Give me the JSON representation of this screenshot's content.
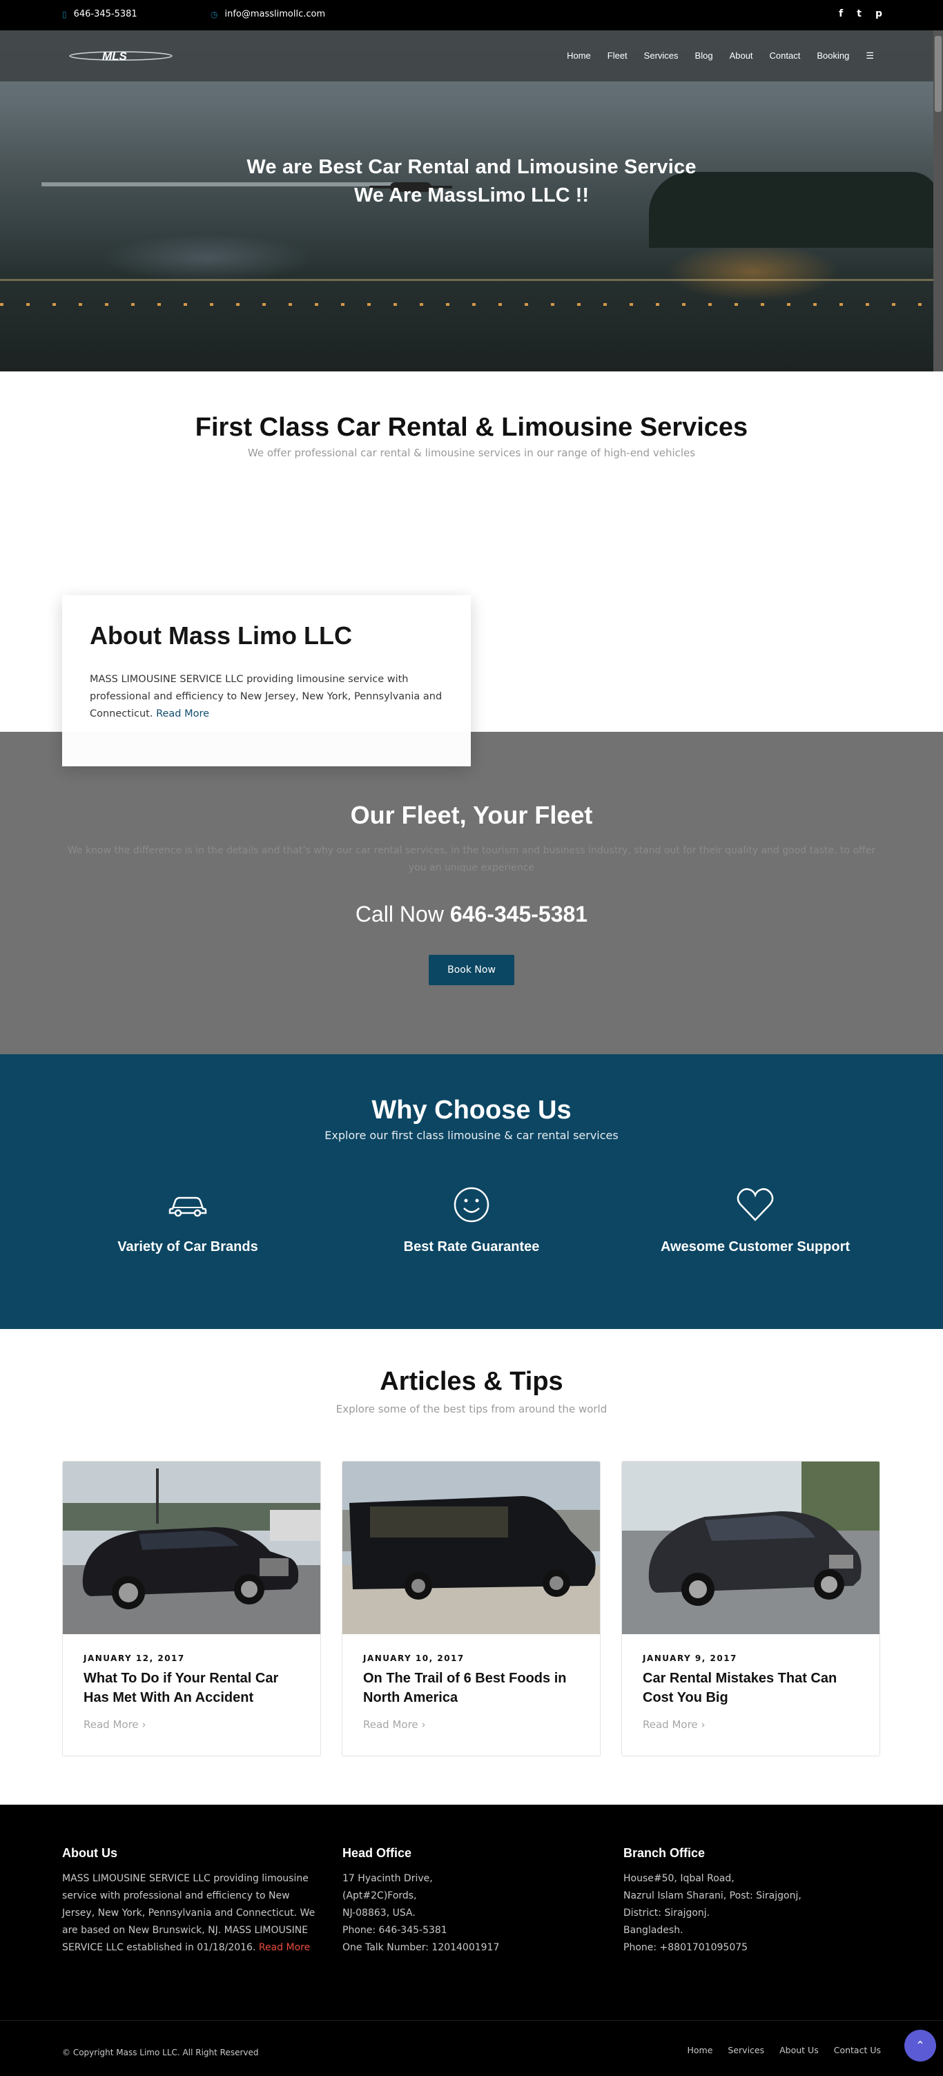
{
  "topbar": {
    "phone": "646-345-5381",
    "email": "info@masslimollc.com",
    "social_icons": [
      "facebook-icon",
      "twitter-icon",
      "pinterest-icon"
    ]
  },
  "nav": {
    "logo_text": "MLS",
    "items": [
      "Home",
      "Fleet",
      "Services",
      "Blog",
      "About",
      "Contact",
      "Booking"
    ],
    "menu_icon": "hamburger-icon"
  },
  "hero": {
    "line1": "We are Best Car Rental and Limousine Service",
    "line2": "We Are MassLimo LLC !!"
  },
  "first_class": {
    "title": "First Class Car Rental & Limousine Services",
    "subtitle": "We offer professional car rental & limousine services in our range of high-end vehicles"
  },
  "about": {
    "title": "About Mass Limo LLC",
    "text": "MASS LIMOUSINE SERVICE LLC providing limousine service with professional and efficiency to New Jersey, New York, Pennsylvania and Connecticut.",
    "read_more": "Read More"
  },
  "fleet": {
    "title": "Our Fleet, Your Fleet",
    "desc": "We know the difference is in the details and that’s why our car rental services, in the tourism and business industry, stand out for their quality and good taste, to offer you an unique experience",
    "call_label": "Call Now",
    "call_number": "646-345-5381",
    "book_button": "Book Now"
  },
  "why": {
    "title": "Why Choose Us",
    "subtitle": "Explore our first class limousine & car rental services",
    "features": [
      {
        "label": "Variety of Car Brands",
        "icon": "car-icon"
      },
      {
        "label": "Best Rate Guarantee",
        "icon": "smile-icon"
      },
      {
        "label": "Awesome Customer Support",
        "icon": "heart-icon"
      }
    ]
  },
  "articles": {
    "title": "Articles & Tips",
    "subtitle": "Explore some of the best tips from around the world",
    "items": [
      {
        "date": "JANUARY 12, 2017",
        "title": "What To Do if Your Rental Car Has Met With An Accident",
        "more": "Read More"
      },
      {
        "date": "JANUARY 10, 2017",
        "title": "On The Trail of 6 Best Foods in North America",
        "more": "Read More"
      },
      {
        "date": "JANUARY 9, 2017",
        "title": "Car Rental Mistakes That Can Cost You Big",
        "more": "Read More"
      }
    ]
  },
  "footer": {
    "about_title": "About Us",
    "about_text": "MASS LIMOUSINE SERVICE LLC providing limousine service with professional and efficiency to New Jersey, New York, Pennsylvania and Connecticut. We are based on New Brunswick, NJ. MASS LIMOUSINE SERVICE LLC established in 01/18/2016.",
    "about_more": "Read More",
    "head_title": "Head Office",
    "head_lines": [
      "17 Hyacinth Drive,",
      "(Apt#2C)Fords,",
      "NJ-08863, USA.",
      "Phone: 646-345-5381",
      "One Talk Number: 12014001917"
    ],
    "branch_title": "Branch Office",
    "branch_lines": [
      "House#50, Iqbal Road,",
      "Nazrul Islam Sharani, Post: Sirajgonj,",
      "District: Sirajgonj.",
      "Bangladesh.",
      "Phone: +8801701095075"
    ],
    "copyright": "© Copyright Mass Limo LLC. All Right Reserved",
    "links": [
      "Home",
      "Services",
      "About Us",
      "Contact Us"
    ]
  },
  "colors": {
    "primary_blue": "#0c4663",
    "accent_red": "#e74c3c",
    "to_top": "#5b5bd6"
  }
}
